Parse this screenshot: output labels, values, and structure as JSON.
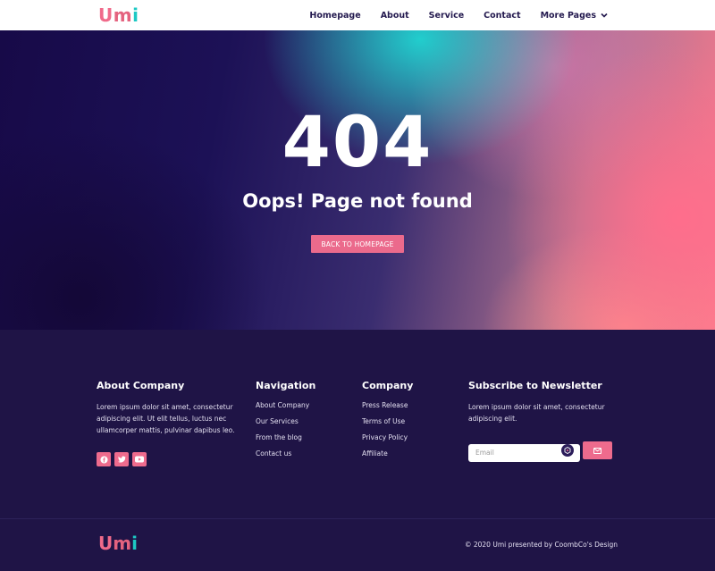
{
  "header": {
    "logo": {
      "u": "U",
      "m": "m",
      "i": "i"
    },
    "nav": [
      "Homepage",
      "About",
      "Service",
      "Contact",
      "More Pages"
    ],
    "more_chevron": "⌄"
  },
  "hero": {
    "code": "404",
    "message": "Oops! Page not found",
    "button": "BACK TO HOMEPAGE"
  },
  "footer": {
    "about": {
      "title": "About Company",
      "text": "Lorem ipsum dolor sit amet, consectetur adipiscing elit. Ut elit tellus, luctus nec ullamcorper mattis, pulvinar dapibus leo.",
      "socials": [
        "facebook-icon",
        "twitter-icon",
        "youtube-icon"
      ]
    },
    "navigation": {
      "title": "Navigation",
      "links": [
        "About Company",
        "Our Services",
        "From the blog",
        "Contact us"
      ]
    },
    "company": {
      "title": "Company",
      "links": [
        "Press Release",
        "Terms of Use",
        "Privacy Policy",
        "Affiliate"
      ]
    },
    "newsletter": {
      "title": "Subscribe to Newsletter",
      "text": "Lorem ipsum dolor sit amet, consectetur adipiscing elit.",
      "placeholder": "Email"
    },
    "logo": {
      "u": "U",
      "m": "m",
      "i": "i"
    },
    "copyright": "© 2020 Umi presented by CoombCo's Design"
  },
  "colors": {
    "accent": "#ee6b8d",
    "teal": "#1dc9c4",
    "footer_bg": "#1f1446",
    "nav_text": "#241a4f"
  }
}
